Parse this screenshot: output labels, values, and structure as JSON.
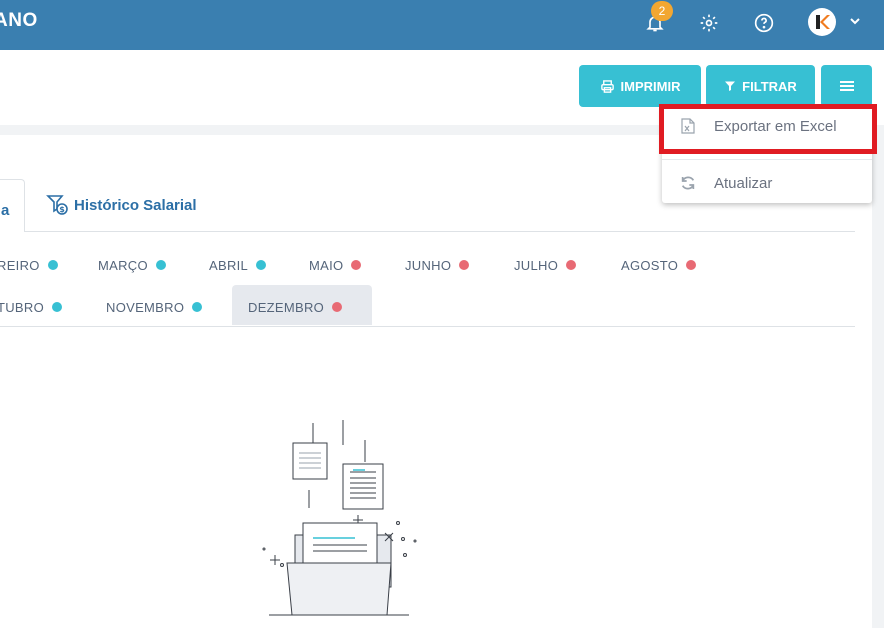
{
  "topbar": {
    "brand": "ANO",
    "notification_count": "2",
    "icons": [
      "bell-icon",
      "gear-icon",
      "help-icon",
      "avatar",
      "chevron-down-icon"
    ],
    "color": "#3a7fb0"
  },
  "toolbar": {
    "print_label": "IMPRIMIR",
    "filter_label": "FILTRAR",
    "accent": "#37c0d3"
  },
  "menu": {
    "items": [
      {
        "label": "Exportar em Excel",
        "icon": "excel-file-icon"
      },
      {
        "label": "Atualizar",
        "icon": "refresh-icon"
      }
    ]
  },
  "tabs": [
    {
      "label": "a"
    },
    {
      "label": "Histórico Salarial",
      "icon": "filter-dollar-icon"
    }
  ],
  "months": [
    {
      "label": "REIRO",
      "status": "ok"
    },
    {
      "label": "MARÇO",
      "status": "ok"
    },
    {
      "label": "ABRIL",
      "status": "ok"
    },
    {
      "label": "MAIO",
      "status": "pending"
    },
    {
      "label": "JUNHO",
      "status": "pending"
    },
    {
      "label": "JULHO",
      "status": "pending"
    },
    {
      "label": "AGOSTO",
      "status": "pending"
    },
    {
      "label": "TUBRO",
      "status": "ok"
    },
    {
      "label": "NOVEMBRO",
      "status": "ok"
    },
    {
      "label": "DEZEMBRO",
      "status": "pending",
      "selected": true
    }
  ],
  "status_colors": {
    "ok": "#37c0d3",
    "pending": "#e86a74"
  }
}
